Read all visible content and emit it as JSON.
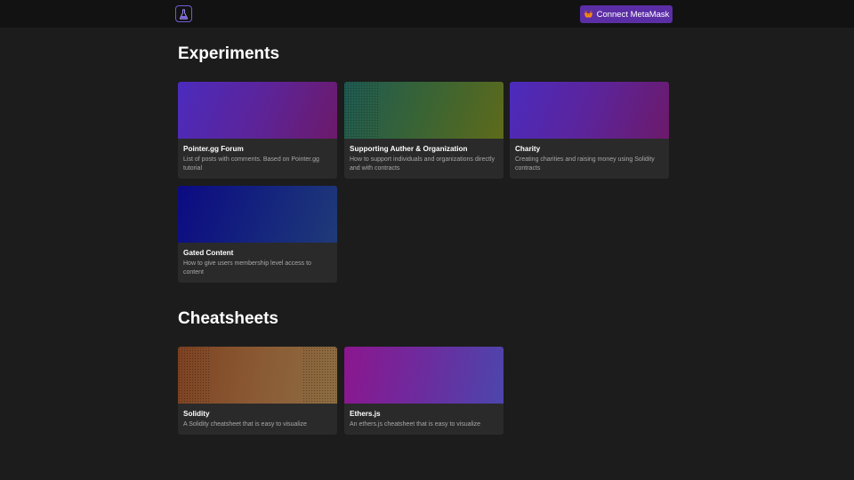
{
  "header": {
    "logo_icon": "flask-icon",
    "connect_label": "Connect MetaMask",
    "connect_icon": "metamask-fox-icon"
  },
  "experiments": {
    "heading": "Experiments",
    "cards": [
      {
        "title": "Pointer.gg Forum",
        "description": "List of posts with comments. Based on Pointer.gg tutorial",
        "gradient": [
          "#4a2bb8",
          "#6b1a6e"
        ]
      },
      {
        "title": "Supporting Auther & Organization",
        "description": "How to support individuals and organizations directly and with contracts",
        "gradient": [
          "#1f5a4f",
          "#5d6a1c"
        ]
      },
      {
        "title": "Charity",
        "description": "Creating charities and raising money using Solidity contracts",
        "gradient": [
          "#4a2bb8",
          "#6b1a6e"
        ]
      },
      {
        "title": "Gated Content",
        "description": "How to give users membership level access to content",
        "gradient": [
          "#0d0d80",
          "#1f3a7a"
        ]
      }
    ]
  },
  "cheatsheets": {
    "heading": "Cheatsheets",
    "cards": [
      {
        "title": "Solidity",
        "description": "A Solidity cheatsheet that is easy to visualize",
        "gradient": [
          "#8a4a2a",
          "#8a6a3a"
        ]
      },
      {
        "title": "Ethers.js",
        "description": "An ethers.js cheatsheet that is easy to visualize",
        "gradient": [
          "#8a1a8a",
          "#5040a8"
        ]
      }
    ]
  }
}
